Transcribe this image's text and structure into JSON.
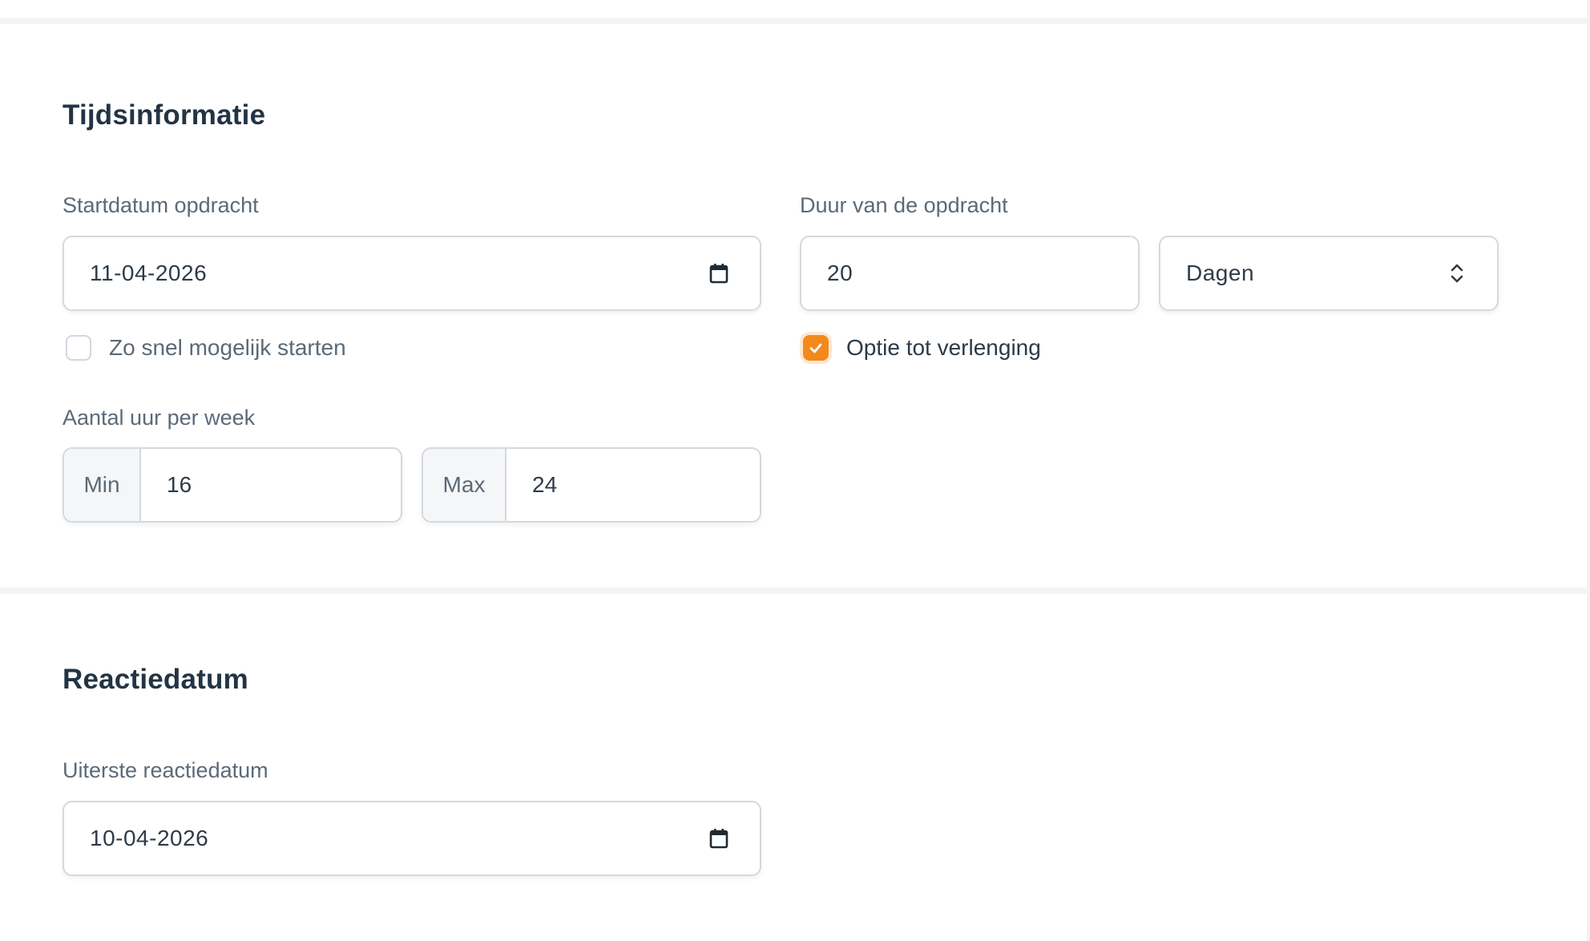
{
  "time_section": {
    "title": "Tijdsinformatie",
    "start_date": {
      "label": "Startdatum opdracht",
      "value": "11-04-2026"
    },
    "asap": {
      "label": "Zo snel mogelijk starten",
      "checked": false
    },
    "duration": {
      "label": "Duur van de opdracht",
      "value": "20",
      "unit_selected": "Dagen"
    },
    "extension": {
      "label": "Optie tot verlenging",
      "checked": true
    },
    "hours": {
      "label": "Aantal uur per week",
      "min_addon": "Min",
      "min_value": "16",
      "max_addon": "Max",
      "max_value": "24"
    }
  },
  "response_section": {
    "title": "Reactiedatum",
    "deadline": {
      "label": "Uiterste reactiedatum",
      "value": "10-04-2026"
    }
  },
  "colors": {
    "accent": "#f28a1b",
    "heading": "#233444",
    "label": "#5b6a78",
    "border": "#d5d9de"
  }
}
